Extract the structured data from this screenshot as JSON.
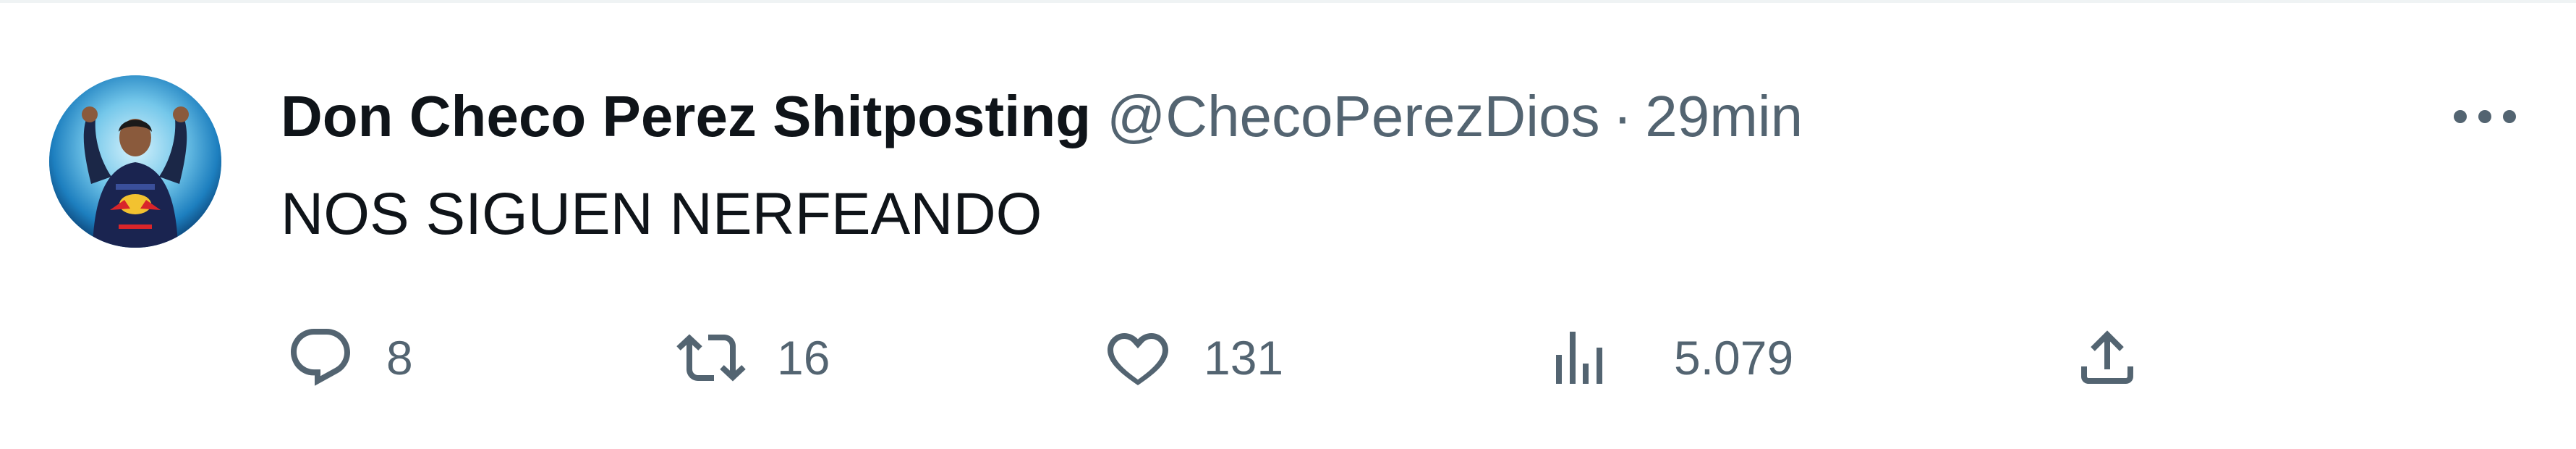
{
  "tweet": {
    "author": {
      "display_name": "Don Checo Perez Shitposting",
      "handle": "@ChecoPerezDios"
    },
    "separator": "·",
    "time": "29min",
    "text": "NOS SIGUEN NERFEANDO",
    "stats": {
      "replies": "8",
      "retweets": "16",
      "likes": "131",
      "views": "5.079"
    }
  },
  "icons": {
    "more": "more-horizontal-icon",
    "reply": "reply-bubble-icon",
    "retweet": "retweet-icon",
    "like": "heart-icon",
    "views": "bar-chart-icon",
    "share": "share-upload-icon"
  },
  "colors": {
    "text_primary": "#0f1419",
    "text_secondary": "#536471",
    "divider": "#eff3f4",
    "avatar_background": "#6cc4e8"
  }
}
